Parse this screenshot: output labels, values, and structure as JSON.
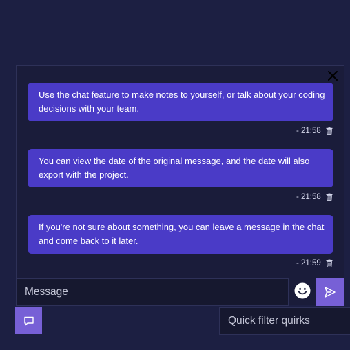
{
  "chat": {
    "messages": [
      {
        "text": "Use the chat feature to make notes to yourself, or talk about your coding decisions with your team.",
        "time": "- 21:58"
      },
      {
        "text": "You can view the date of the original message, and the date will also export with the project.",
        "time": "- 21:58"
      },
      {
        "text": "If you're not sure about something, you can leave a message in the chat and come back to it later.",
        "time": "- 21:59"
      }
    ],
    "input_placeholder": "Message"
  },
  "filter": {
    "placeholder": "Quick filter quirks"
  },
  "icons": {
    "close": "close-icon",
    "trash": "trash-icon",
    "emoji": "emoji-icon",
    "send": "send-icon",
    "chat_toggle": "chat-bubble-icon"
  },
  "colors": {
    "background": "#1c1f42",
    "panel": "#1a1c3a",
    "bubble": "#4a3bc7",
    "accent": "#7760d6"
  }
}
